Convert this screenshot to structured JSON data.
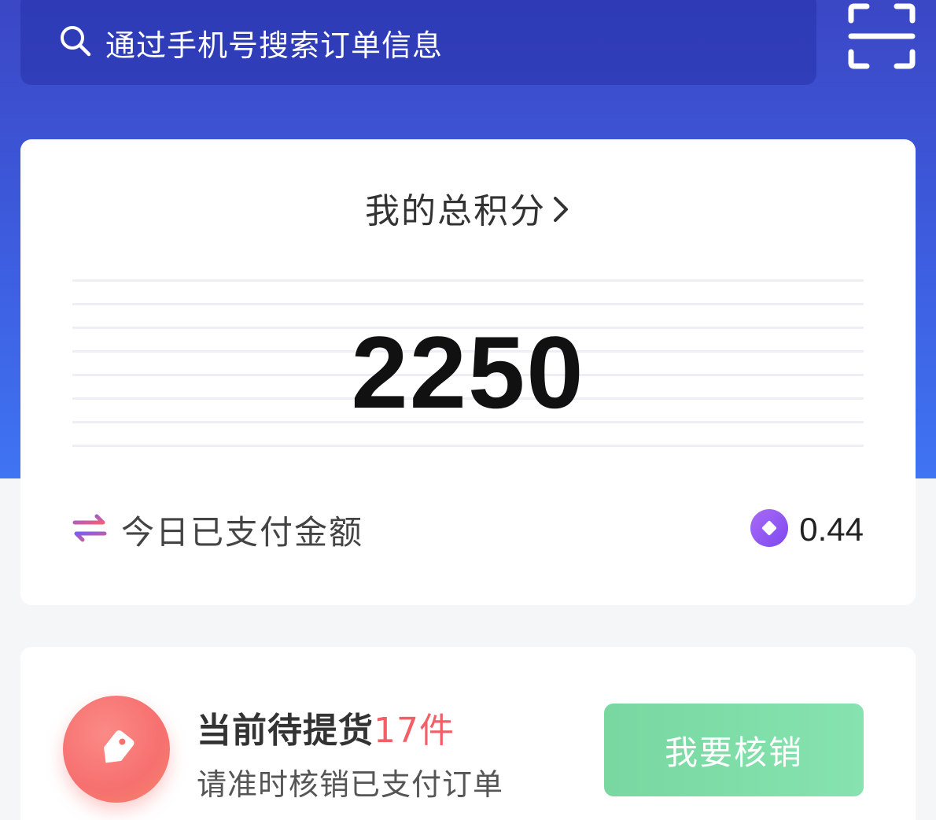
{
  "search": {
    "placeholder": "通过手机号搜索订单信息",
    "icon": "search-icon"
  },
  "scan": {
    "icon": "scan-icon"
  },
  "points": {
    "title": "我的总积分",
    "value": "2250"
  },
  "paid_today": {
    "label": "今日已支付金额",
    "value": "0.44",
    "label_icon": "exchange-icon",
    "value_icon": "coin-icon"
  },
  "pickup": {
    "title": "当前待提货",
    "count": "17件",
    "subtitle": "请准时核销已支付订单",
    "button_label": "我要核销",
    "icon": "tag-icon"
  },
  "colors": {
    "header_gradient_top": "#3b47c5",
    "header_gradient_bottom": "#3f74f2",
    "accent_red": "#f35f68",
    "button_green": "#78d8a0",
    "coin_purple": "#8a4ff0"
  }
}
